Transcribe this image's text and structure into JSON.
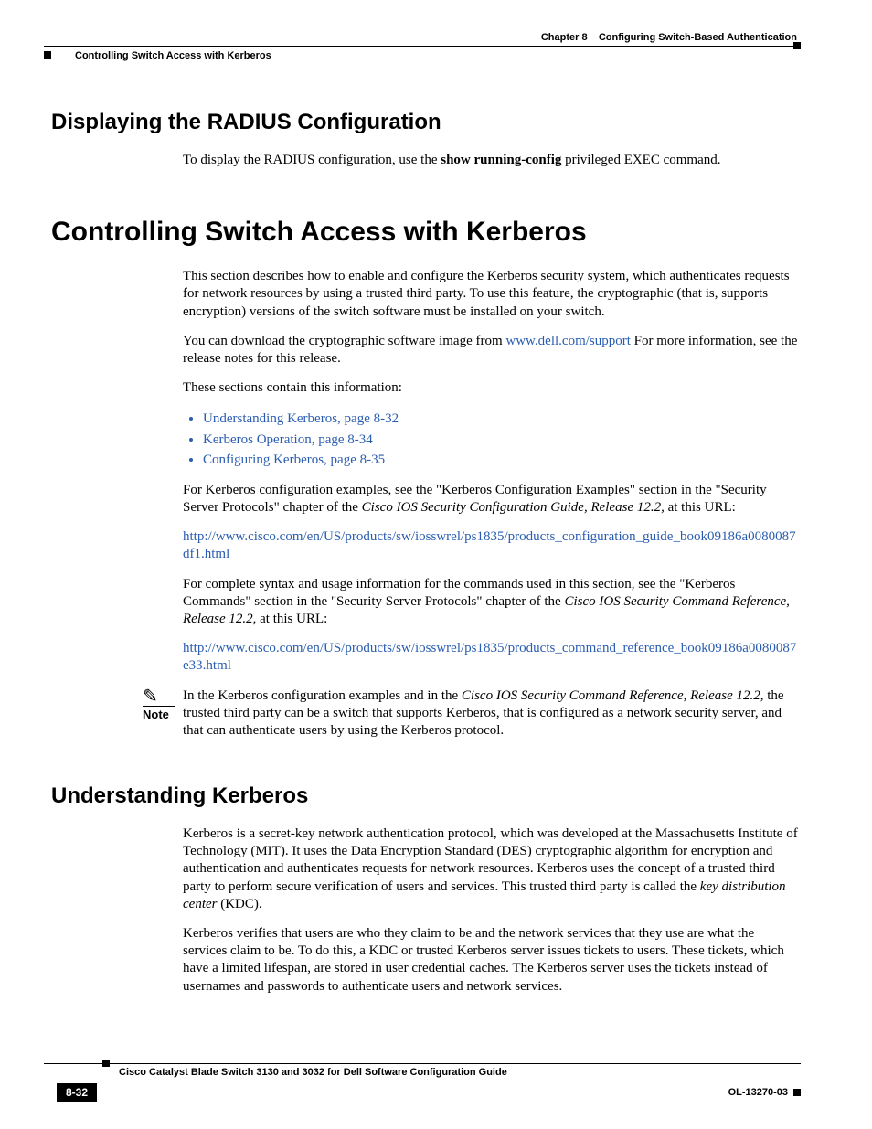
{
  "header": {
    "chapter": "Chapter 8",
    "chapter_title": "Configuring Switch-Based Authentication",
    "running_section": "Controlling Switch Access with Kerberos"
  },
  "section1": {
    "heading": "Displaying the RADIUS Configuration",
    "p1_pre": "To display the RADIUS configuration, use the ",
    "p1_bold": "show running-config",
    "p1_post": " privileged EXEC command."
  },
  "main": {
    "heading": "Controlling Switch Access with Kerberos",
    "p1": "This section describes how to enable and configure the Kerberos security system, which authenticates requests for network resources by using a trusted third party. To use this feature, the cryptographic (that is, supports encryption) versions of the switch software must be installed on your switch.",
    "p2_pre": "You can download the cryptographic software image from ",
    "p2_link": "www.dell.com/support",
    "p2_post": " For more information, see the release notes for this release.",
    "p3": "These sections contain this information:",
    "bullets": [
      "Understanding Kerberos, page 8-32",
      "Kerberos Operation, page 8-34",
      "Configuring Kerberos, page 8-35"
    ],
    "p4_pre": "For Kerberos configuration examples, see the \"Kerberos Configuration Examples\" section in the \"Security Server Protocols\" chapter of the ",
    "p4_italic": "Cisco IOS Security Configuration Guide, Release 12.2,",
    "p4_post": " at this URL:",
    "url1": "http://www.cisco.com/en/US/products/sw/iosswrel/ps1835/products_configuration_guide_book09186a0080087df1.html",
    "p5_pre": "For complete syntax and usage information for the commands used in this section, see the \"Kerberos Commands\" section in the \"Security Server Protocols\" chapter of the ",
    "p5_italic": "Cisco IOS Security Command Reference, Release 12.2,",
    "p5_post": " at this URL:",
    "url2": "http://www.cisco.com/en/US/products/sw/iosswrel/ps1835/products_command_reference_book09186a0080087e33.html"
  },
  "note": {
    "label": "Note",
    "text_pre": "In the Kerberos configuration examples and in the ",
    "text_italic": "Cisco IOS Security Command Reference, Release 12.2,",
    "text_post": " the trusted third party can be a switch that supports Kerberos, that is configured as a network security server, and that can authenticate users by using the Kerberos protocol."
  },
  "section2": {
    "heading": "Understanding Kerberos",
    "p1_pre": "Kerberos is a secret-key network authentication protocol, which was developed at the Massachusetts Institute of Technology (MIT). It uses the Data Encryption Standard (DES) cryptographic algorithm for encryption and authentication and authenticates requests for network resources. Kerberos uses the concept of a trusted third party to perform secure verification of users and services. This trusted third party is called the ",
    "p1_italic": "key distribution center",
    "p1_post": " (KDC).",
    "p2": "Kerberos verifies that users are who they claim to be and the network services that they use are what the services claim to be. To do this, a KDC or trusted Kerberos server issues tickets to users. These tickets, which have a limited lifespan, are stored in user credential caches. The Kerberos server uses the tickets instead of usernames and passwords to authenticate users and network services."
  },
  "footer": {
    "book_title": "Cisco Catalyst Blade Switch 3130 and 3032 for Dell Software Configuration Guide",
    "page_number": "8-32",
    "doc_id": "OL-13270-03"
  }
}
